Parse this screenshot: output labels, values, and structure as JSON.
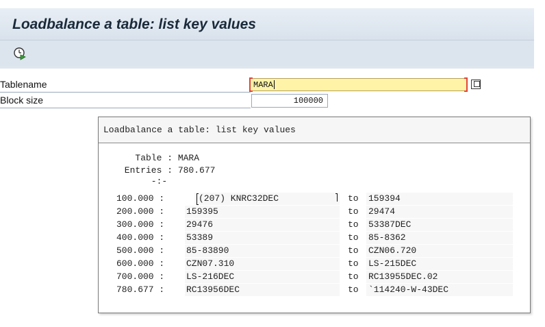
{
  "window": {
    "title": "Loadbalance a table: list key values"
  },
  "toolbar": {
    "execute_icon": "execute-clock-icon"
  },
  "form": {
    "tablename_label": "Tablename",
    "tablename_value": "MARA",
    "blocksize_label": "Block size",
    "blocksize_value": "100000"
  },
  "popup": {
    "title": "Loadbalance a table: list key values",
    "table_line": "   Table : MARA",
    "entries_line": " Entries : 780.677",
    "separator": "      -:-",
    "rows": [
      {
        "count": "100.000 :",
        "from": "(207) KNRC32DEC",
        "to_label": "to",
        "to": "159394"
      },
      {
        "count": "200.000 :",
        "from": "159395",
        "to_label": "to",
        "to": "29474"
      },
      {
        "count": "300.000 :",
        "from": "29476",
        "to_label": "to",
        "to": "53387DEC"
      },
      {
        "count": "400.000 :",
        "from": "53389",
        "to_label": "to",
        "to": "85-8362"
      },
      {
        "count": "500.000 :",
        "from": "85-83890",
        "to_label": "to",
        "to": "CZN06.720"
      },
      {
        "count": "600.000 :",
        "from": "CZN07.310",
        "to_label": "to",
        "to": "LS-215DEC"
      },
      {
        "count": "700.000 :",
        "from": "LS-216DEC",
        "to_label": "to",
        "to": "RC13955DEC.02"
      },
      {
        "count": "780.677 :",
        "from": "RC13956DEC",
        "to_label": "to",
        "to": "`114240-W-43DEC"
      }
    ]
  }
}
